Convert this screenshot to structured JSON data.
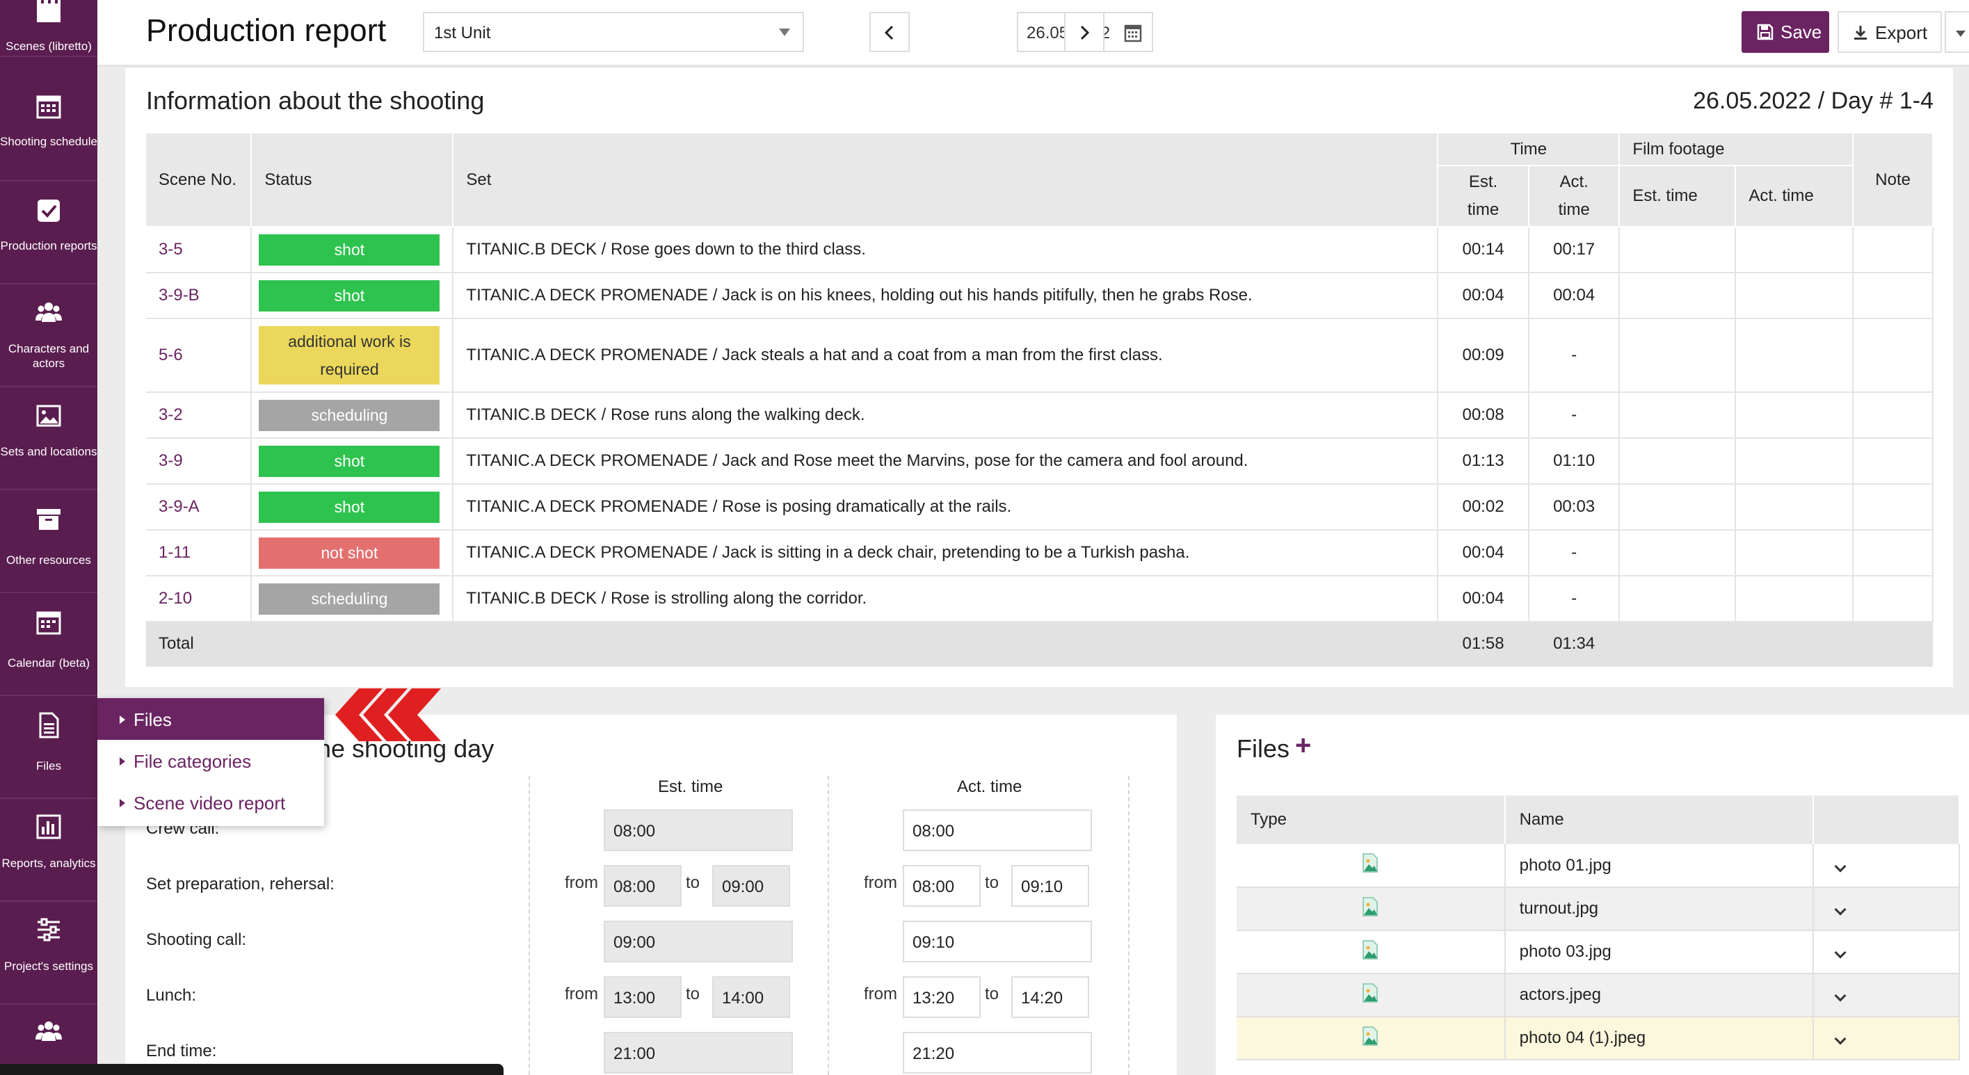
{
  "sidebar": {
    "items": [
      {
        "label": "Scenes (libretto)",
        "icon": "clapperboard-icon"
      },
      {
        "label": "Shooting schedule",
        "icon": "calendar-grid-icon"
      },
      {
        "label": "Production reports",
        "icon": "checkbox-icon"
      },
      {
        "label": "Characters and actors",
        "icon": "people-icon"
      },
      {
        "label": "Sets and locations",
        "icon": "image-icon"
      },
      {
        "label": "Other resources",
        "icon": "archive-box-icon"
      },
      {
        "label": "Calendar (beta)",
        "icon": "calendar-icon"
      },
      {
        "label": "Files",
        "icon": "document-icon"
      },
      {
        "label": "Reports, analytics",
        "icon": "bar-chart-icon"
      },
      {
        "label": "Project's settings",
        "icon": "sliders-icon"
      },
      {
        "label": "",
        "icon": "people-icon"
      }
    ]
  },
  "header": {
    "title": "Production report",
    "unit": "1st Unit",
    "date": "26.05.2022",
    "save_label": "Save",
    "export_label": "Export"
  },
  "info": {
    "title": "Information about the shooting",
    "date_day": "26.05.2022 / Day # 1-4",
    "columns": {
      "scene_no": "Scene No.",
      "status": "Status",
      "set": "Set",
      "time": "Time",
      "film_footage": "Film footage",
      "note": "Note",
      "est_time_1": "Est.",
      "est_time_2": "time",
      "act_time_1": "Act.",
      "act_time_2": "time",
      "ff_est": "Est. time",
      "ff_act": "Act. time"
    },
    "rows": [
      {
        "scene": "3-5",
        "status": "shot",
        "set": "TITANIC.B DECK / Rose goes down to the third class.",
        "est": "00:14",
        "act": "00:17"
      },
      {
        "scene": "3-9-B",
        "status": "shot",
        "set": "TITANIC.A DECK PROMENADE / Jack is on his knees, holding out his hands pitifully, then he grabs Rose.",
        "est": "00:04",
        "act": "00:04"
      },
      {
        "scene": "5-6",
        "status": "additional work is required",
        "set": "TITANIC.A DECK PROMENADE / Jack steals a hat and a coat from a man from the first class.",
        "est": "00:09",
        "act": "-"
      },
      {
        "scene": "3-2",
        "status": "scheduling",
        "set": "TITANIC.B DECK / Rose runs along the walking deck.",
        "est": "00:08",
        "act": "-"
      },
      {
        "scene": "3-9",
        "status": "shot",
        "set": "TITANIC.A DECK PROMENADE / Jack and Rose meet the Marvins, pose for the camera and fool around.",
        "est": "01:13",
        "act": "01:10"
      },
      {
        "scene": "3-9-A",
        "status": "shot",
        "set": "TITANIC.A DECK PROMENADE / Rose is posing dramatically at the rails.",
        "est": "00:02",
        "act": "00:03"
      },
      {
        "scene": "1-11",
        "status": "not shot",
        "set": "TITANIC.A DECK PROMENADE / Jack is sitting in a deck chair, pretending to be a Turkish pasha.",
        "est": "00:04",
        "act": "-"
      },
      {
        "scene": "2-10",
        "status": "scheduling",
        "set": "TITANIC.B DECK / Rose is strolling along the corridor.",
        "est": "00:04",
        "act": "-"
      }
    ],
    "total": {
      "label": "Total",
      "est": "01:58",
      "act": "01:34"
    }
  },
  "status_colors": {
    "shot": "#2ec24f",
    "additional": "#ead75b",
    "scheduling": "#a5a5a5",
    "not_shot": "#e46f6f"
  },
  "day": {
    "title_visible": "he shooting day",
    "est_head": "Est. time",
    "act_head": "Act. time",
    "from": "from",
    "to": "to",
    "rows": [
      {
        "label": "Crew call:",
        "est": "08:00",
        "act": "08:00"
      },
      {
        "label": "Set preparation, rehersal:",
        "est_from": "08:00",
        "est_to": "09:00",
        "act_from": "08:00",
        "act_to": "09:10"
      },
      {
        "label": "Shooting call:",
        "est": "09:00",
        "act": "09:10"
      },
      {
        "label": "Lunch:",
        "est_from": "13:00",
        "est_to": "14:00",
        "act_from": "13:20",
        "act_to": "14:20"
      },
      {
        "label": "End time:",
        "est": "21:00",
        "act": "21:20"
      }
    ]
  },
  "files": {
    "title": "Files",
    "plus": "+",
    "col_type": "Type",
    "col_name": "Name",
    "rows": [
      {
        "name": "photo 01.jpg"
      },
      {
        "name": "turnout.jpg"
      },
      {
        "name": "photo 03.jpg"
      },
      {
        "name": "actors.jpeg"
      },
      {
        "name": "photo 04 (1).jpeg"
      }
    ]
  },
  "flyout": {
    "items": [
      "Files",
      "File categories",
      "Scene video report"
    ]
  },
  "brand_color": "#6b2462"
}
